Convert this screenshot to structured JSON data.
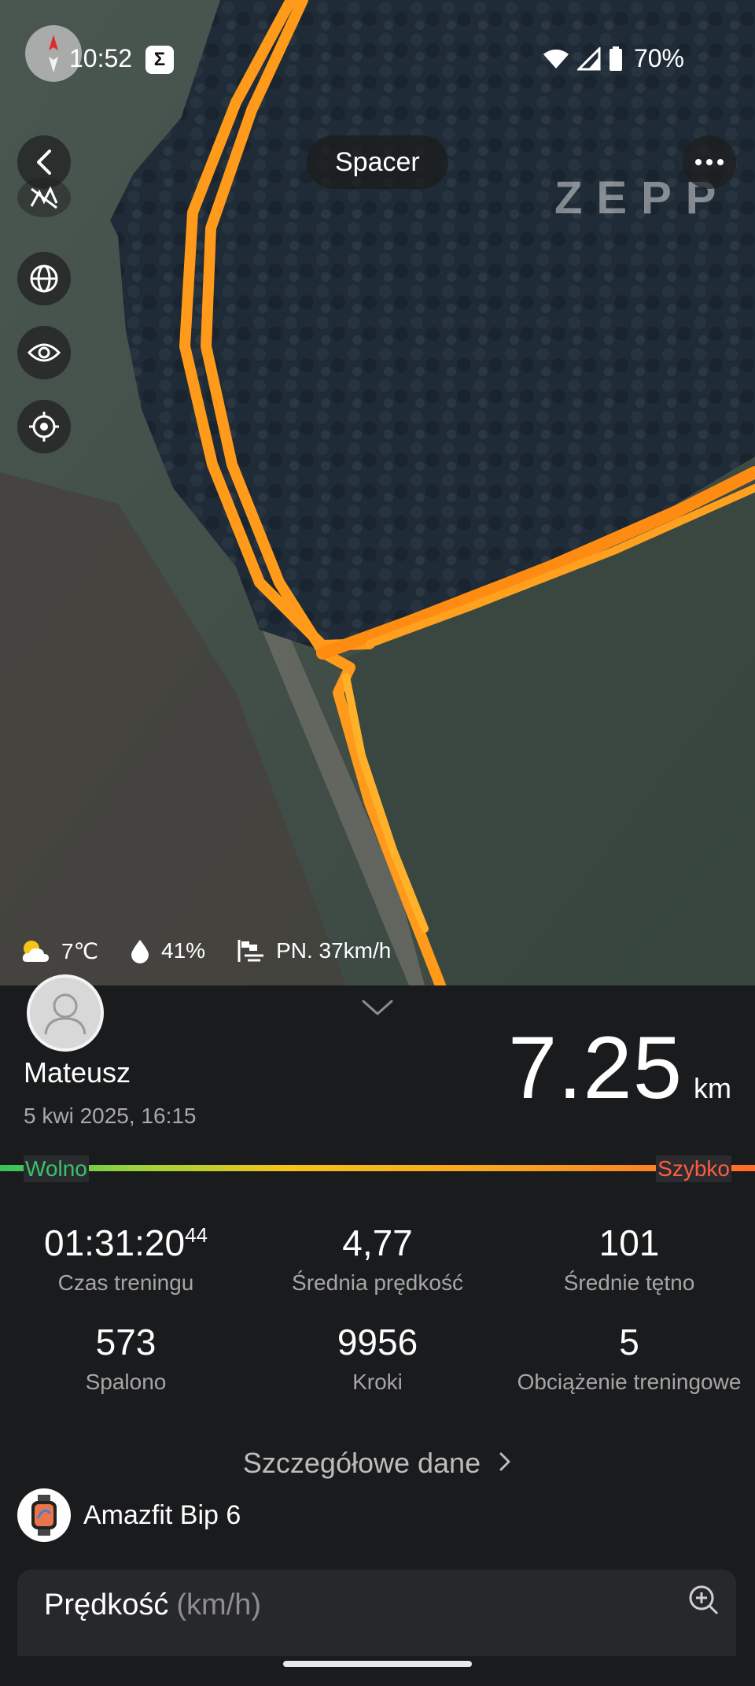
{
  "status_bar": {
    "time": "10:52",
    "app_indicator": "Σ",
    "battery": "70%",
    "icons": [
      "wifi-icon",
      "signal-icon",
      "battery-icon"
    ]
  },
  "map": {
    "activity_title": "Spacer",
    "logo": "ZEPP",
    "route_color": "#ff9a1a",
    "controls": [
      "back-icon",
      "more-icon",
      "heatmap-toggle-icon",
      "globe-icon",
      "eye-icon",
      "locate-icon"
    ],
    "weather": {
      "temperature": "7℃",
      "humidity": "41%",
      "wind": "PN. 37km/h"
    }
  },
  "summary": {
    "user_name": "Mateusz",
    "date": "5 kwi 2025, 16:15",
    "distance_value": "7.25",
    "distance_unit": "km",
    "speed_scale": {
      "slow_label": "Wolno",
      "fast_label": "Szybko",
      "slow_color": "#38c46b",
      "fast_color": "#ff5b3e"
    }
  },
  "stats": [
    {
      "value": "01:31:20",
      "value_sup": "44",
      "label": "Czas treningu"
    },
    {
      "value": "4,77",
      "label": "Średnia prędkość"
    },
    {
      "value": "101",
      "label": "Średnie tętno"
    },
    {
      "value": "573",
      "label": "Spalono"
    },
    {
      "value": "9956",
      "label": "Kroki"
    },
    {
      "value": "5",
      "label": "Obciążenie treningowe"
    }
  ],
  "details_link": "Szczegółowe dane",
  "device": {
    "name": "Amazfit Bip 6"
  },
  "speed_chart": {
    "title": "Prędkość",
    "unit": "(km/h)"
  }
}
